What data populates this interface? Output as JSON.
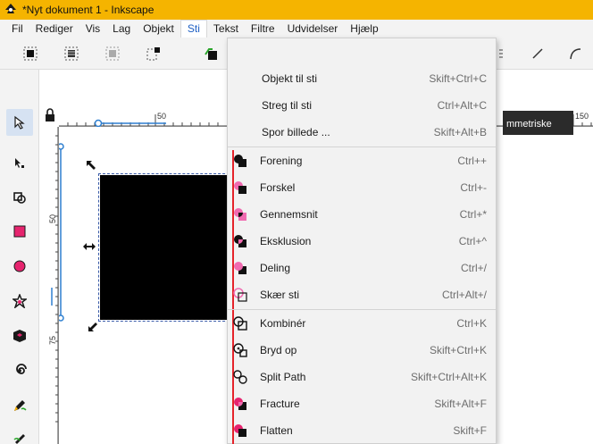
{
  "window": {
    "title": "*Nyt dokument 1 - Inkscape",
    "app_icon": "inkscape-icon"
  },
  "menubar": [
    "Fil",
    "Rediger",
    "Vis",
    "Lag",
    "Objekt",
    "Sti",
    "Tekst",
    "Filtre",
    "Udvidelser",
    "Hjælp"
  ],
  "active_menu": "Sti",
  "commands_bar_icons": [
    "select-all-icon",
    "select-all-in-all-layers-icon",
    "deselect-icon",
    "select-same-icon",
    "path-tool-icon",
    "zoom-icon",
    "line-icon",
    "curve-icon"
  ],
  "toolbox_icons": [
    "selector-tool-icon",
    "node-tool-icon",
    "tweak-tool-icon",
    "rectangle-tool-icon",
    "circle-tool-icon",
    "star-tool-icon",
    "3d-box-tool-icon",
    "spiral-tool-icon",
    "pencil-tool-icon",
    "pen-tool-icon"
  ],
  "rulers": {
    "h_labels": [
      "50",
      "150"
    ],
    "v_labels": [
      "50",
      "75"
    ]
  },
  "tooltip": {
    "text": "mmetriske"
  },
  "dropdown": {
    "items": [
      {
        "label": "Objekt til sti",
        "shortcut": "Skift+Ctrl+C",
        "icon": ""
      },
      {
        "label": "Streg til sti",
        "shortcut": "Ctrl+Alt+C",
        "icon": ""
      },
      {
        "label": "Spor billede ...",
        "shortcut": "Skift+Alt+B",
        "icon": ""
      },
      {
        "label": "Forening",
        "shortcut": "Ctrl++",
        "icon": "union-icon"
      },
      {
        "label": "Forskel",
        "shortcut": "Ctrl+-",
        "icon": "difference-icon"
      },
      {
        "label": "Gennemsnit",
        "shortcut": "Ctrl+*",
        "icon": "intersection-icon"
      },
      {
        "label": "Eksklusion",
        "shortcut": "Ctrl+^",
        "icon": "exclusion-icon"
      },
      {
        "label": "Deling",
        "shortcut": "Ctrl+/",
        "icon": "division-icon"
      },
      {
        "label": "Skær sti",
        "shortcut": "Ctrl+Alt+/",
        "icon": "cut-path-icon"
      },
      {
        "label": "Kombinér",
        "shortcut": "Ctrl+K",
        "icon": "combine-icon"
      },
      {
        "label": "Bryd op",
        "shortcut": "Skift+Ctrl+K",
        "icon": "break-apart-icon"
      },
      {
        "label": "Split Path",
        "shortcut": "Skift+Ctrl+Alt+K",
        "icon": "split-path-icon"
      },
      {
        "label": "Fracture",
        "shortcut": "Skift+Alt+F",
        "icon": "fracture-icon"
      },
      {
        "label": "Flatten",
        "shortcut": "Skift+F",
        "icon": "flatten-icon"
      }
    ]
  },
  "colors": {
    "titlebar": "#f5b400",
    "accent": "#1e5fc4",
    "guide_line": "#e5242b",
    "pink": "#f06ab0",
    "selection": "#2f7fd0"
  }
}
